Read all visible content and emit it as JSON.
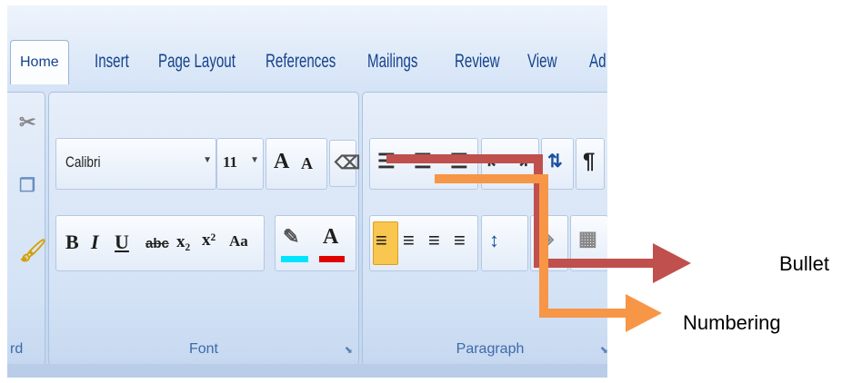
{
  "tabs": [
    {
      "label": "Home",
      "active": true
    },
    {
      "label": "Insert"
    },
    {
      "label": "Page Layout"
    },
    {
      "label": "References"
    },
    {
      "label": "Mailings"
    },
    {
      "label": "Review"
    },
    {
      "label": "View"
    },
    {
      "label": "Ad"
    }
  ],
  "clipboard": {
    "label": "rd"
  },
  "font": {
    "name": "Calibri",
    "size": "11",
    "group_label": "Font",
    "bold": "B",
    "italic": "I",
    "underline": "U",
    "strike": "abc",
    "subscript": "x₂",
    "superscript": "x²",
    "change_case": "Aa",
    "grow": "A",
    "shrink": "A"
  },
  "paragraph": {
    "group_label": "Paragraph",
    "pilcrow": "¶"
  },
  "annotations": {
    "bullet": "Bullet",
    "numbering": "Numbering",
    "bullet_color": "#c0504d",
    "numbering_color": "#f79646"
  },
  "colors": {
    "highlight_bar": "#00e5ff",
    "font_color_bar": "#e00000"
  }
}
